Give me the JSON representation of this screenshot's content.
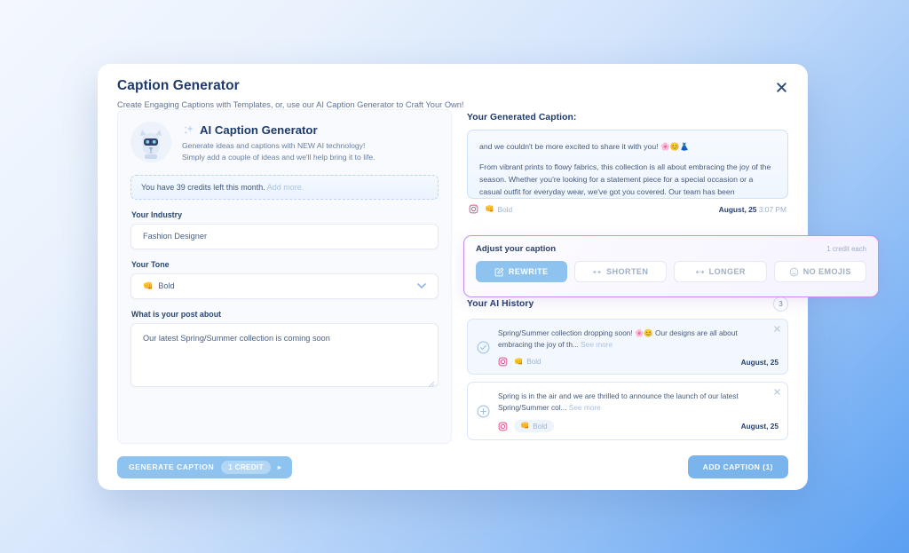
{
  "modal": {
    "title": "Caption Generator",
    "subtitle": "Create Engaging Captions with Templates, or, use our AI Caption Generator to Craft Your Own!",
    "close_icon": "close-icon"
  },
  "ai_promo": {
    "sparkle_icon": "sparkle-icon",
    "avatar_icon": "robot-mascot-avatar",
    "title": "AI Caption Generator",
    "desc_line1": "Generate ideas and captions with NEW AI technology!",
    "desc_line2": "Simply add a couple of ideas and we'll help bring it to life."
  },
  "credits": {
    "text": "You have 39 credits left this month.",
    "link": "Add more.",
    "count": 39
  },
  "form": {
    "industry_label": "Your Industry",
    "industry_value": "Fashion Designer",
    "industry_placeholder": "Your Industry",
    "tone_label": "Your Tone",
    "tone_value": "Bold",
    "tone_emoji": "👊",
    "chevron_icon": "chevron-down-icon",
    "post_label": "What is your post about",
    "post_value": "Our latest Spring/Summer collection is coming soon",
    "post_placeholder": "What is your post about"
  },
  "generated": {
    "heading": "Your Generated Caption:",
    "paragraph1": "and we couldn't be more excited to share it with you! 🌸😊👗",
    "paragraph2": "From vibrant prints to flowy fabrics, this collection is all about embracing the joy of the season. Whether you're looking for a statement piece for a special occasion or a casual outfit for everyday wear, we've got you covered. Our team has been",
    "platform_icon": "instagram-icon",
    "tone": "Bold",
    "tone_emoji": "👊",
    "date": "August, 25",
    "time": "3:07 PM"
  },
  "adjust": {
    "title": "Adjust your caption",
    "credit_note": "1 credit each",
    "buttons": [
      {
        "label": "REWRITE",
        "icon": "edit-square-icon",
        "style": "primary"
      },
      {
        "label": "SHORTEN",
        "icon": "arrows-in-icon",
        "style": "ghost"
      },
      {
        "label": "LONGER",
        "icon": "arrows-out-icon",
        "style": "ghost"
      },
      {
        "label": "NO EMOJIS",
        "icon": "smiley-off-icon",
        "style": "ghost"
      }
    ]
  },
  "history": {
    "heading": "Your AI History",
    "count": "3",
    "items": [
      {
        "text": "Spring/Summer collection dropping soon! 🌸😊 Our designs are all about embracing the joy of th...",
        "see_more": "See more",
        "state_icon": "check-circle-icon",
        "platform_icon": "instagram-icon",
        "tone": "Bold",
        "tone_emoji": "👊",
        "date": "August, 25",
        "close_icon": "close-icon"
      },
      {
        "text": "Spring is in the air and we are thrilled to announce the launch of our latest Spring/Summer col...",
        "see_more": "See more",
        "state_icon": "plus-circle-icon",
        "platform_icon": "instagram-icon",
        "tone": "Bold",
        "tone_emoji": "👊",
        "date": "August, 25",
        "close_icon": "close-icon"
      }
    ]
  },
  "footer": {
    "generate_label": "GENERATE CAPTION",
    "generate_credit": "1 CREDIT",
    "generate_arrow": "▸",
    "add_label": "ADD CAPTION (1)"
  },
  "colors": {
    "accent_blue": "#8ec2ef",
    "accent_purple": "#c58df0",
    "text_dark": "#1e3a6b",
    "bg_blue": "#5ba0f2"
  }
}
